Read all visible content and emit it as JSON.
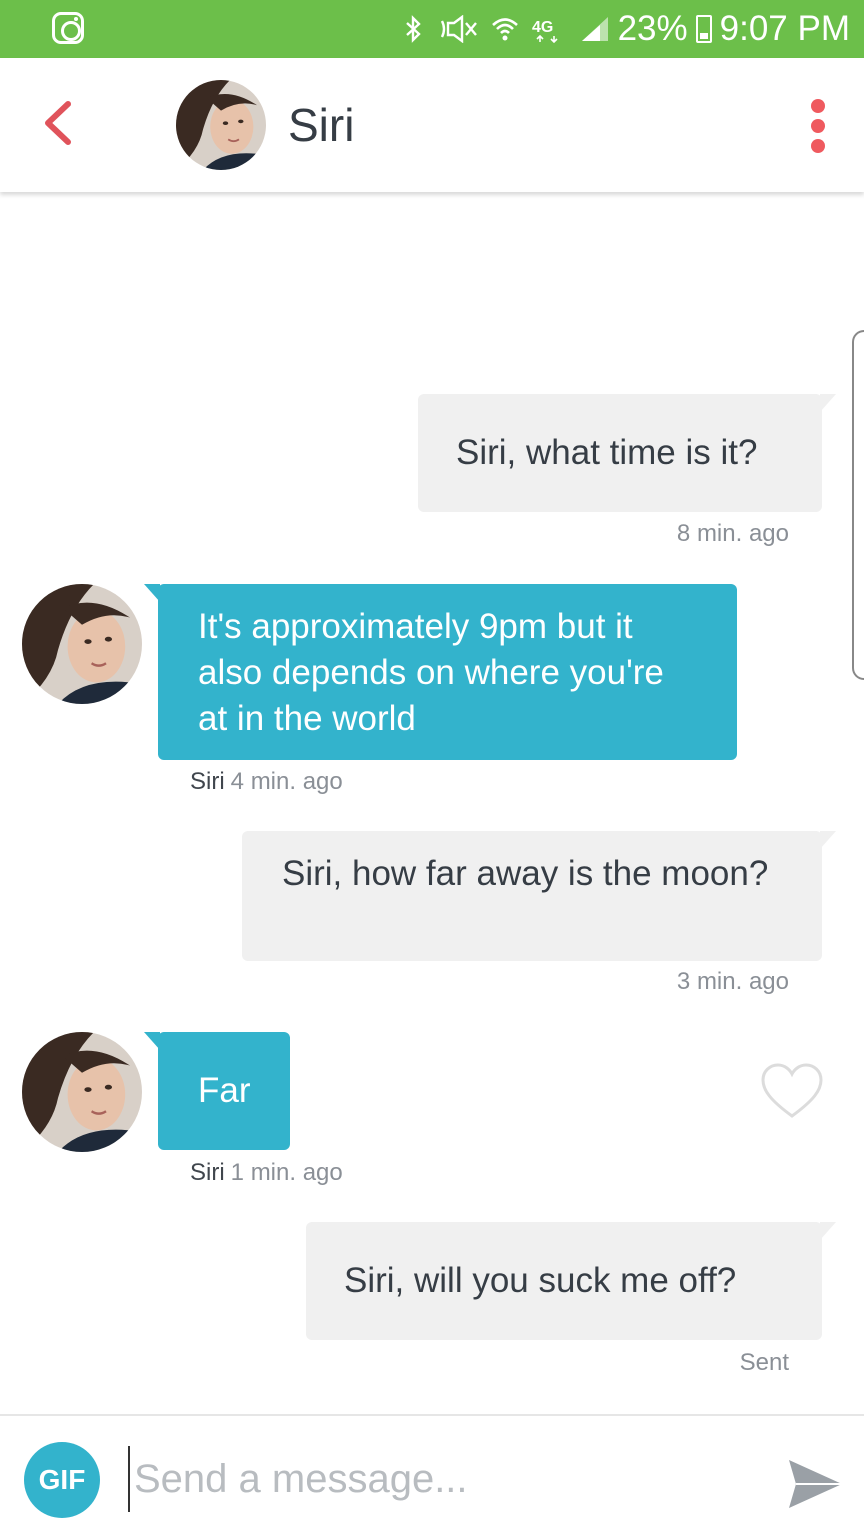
{
  "status_bar": {
    "battery": "23%",
    "time": "9:07 PM",
    "icons": [
      "instagram-icon",
      "bluetooth-icon",
      "mute-icon",
      "wifi-icon",
      "4g-icon",
      "signal-icon",
      "battery-charging-icon"
    ]
  },
  "header": {
    "name": "Siri",
    "back_icon": "chevron-left-icon",
    "menu_icon": "more-vertical-icon"
  },
  "messages": [
    {
      "direction": "out",
      "text": "Siri, what time is it?",
      "time": "8 min. ago"
    },
    {
      "direction": "in",
      "sender": "Siri",
      "text": "It's approximately 9pm but it also depends on where you're at in the world",
      "time": "4 min. ago"
    },
    {
      "direction": "out",
      "text": "Siri,  how far away is the moon?",
      "time": "3 min. ago"
    },
    {
      "direction": "in",
      "sender": "Siri",
      "text": "Far",
      "time": "1 min. ago"
    },
    {
      "direction": "out",
      "text": "Siri,  will you suck me off?",
      "time": "Sent"
    }
  ],
  "composer": {
    "gif_label": "GIF",
    "placeholder": "Send a message...",
    "value": ""
  },
  "colors": {
    "status_bar": "#6cbf4a",
    "accent": "#33b3cc",
    "back_icon": "#e0535b",
    "menu_icon": "#ef5a5f",
    "outgoing_bubble": "#f0f0f0"
  }
}
